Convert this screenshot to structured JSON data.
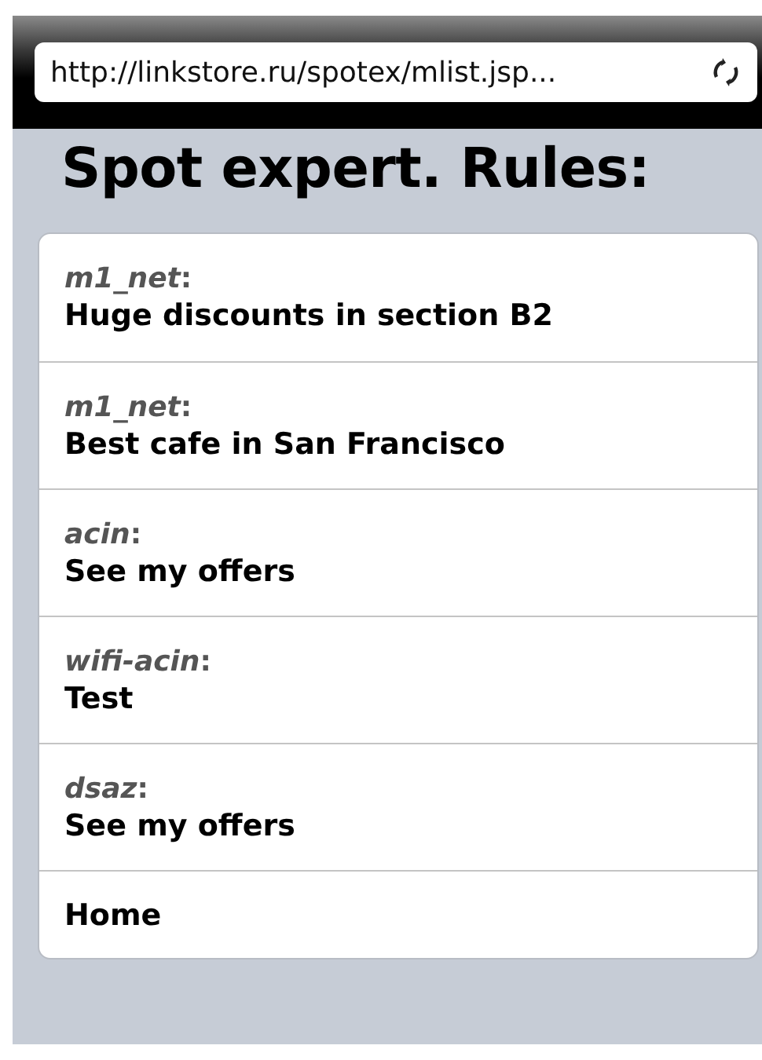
{
  "address_bar": {
    "url": "http://linkstore.ru/spotex/mlist.jsp..."
  },
  "page": {
    "title": "Spot expert. Rules:"
  },
  "list": [
    {
      "kind": "rule",
      "author": "*m1_net*:",
      "text": "Huge discounts in section B2"
    },
    {
      "kind": "rule",
      "author": "*m1_net*:",
      "text": "Best cafe in San Francisco"
    },
    {
      "kind": "rule",
      "author": "*acin*:",
      "text": "See my offers"
    },
    {
      "kind": "rule",
      "author": "*wifi-acin*:",
      "text": "Test"
    },
    {
      "kind": "rule",
      "author": "*dsaz*:",
      "text": "See my offers"
    },
    {
      "kind": "link",
      "text": "Home"
    }
  ]
}
